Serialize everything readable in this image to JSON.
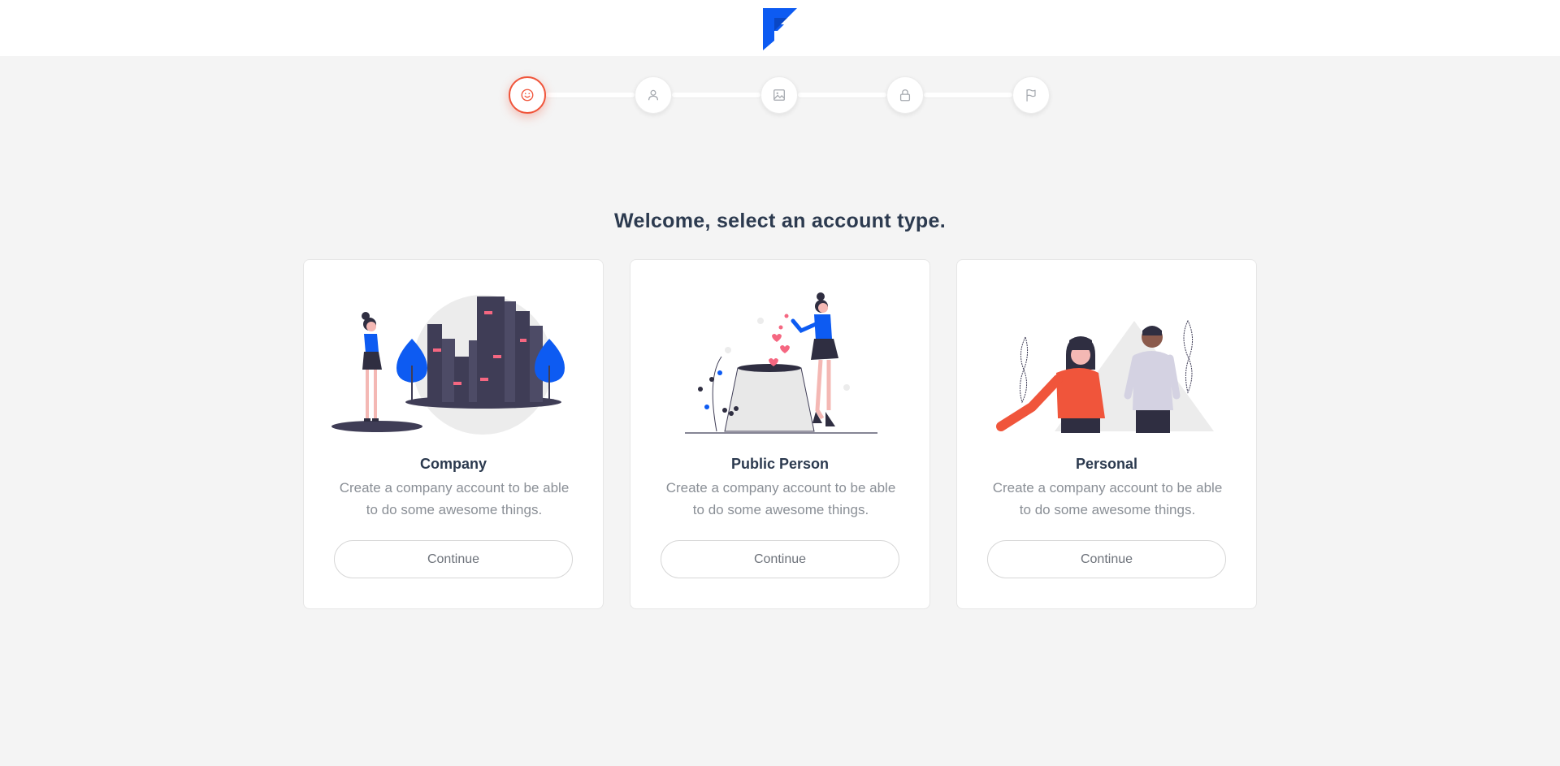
{
  "header": {
    "logo_icon": "flex-logo-icon",
    "brand_color": "#0d5bf2"
  },
  "stepper": {
    "active_color": "#f0553b",
    "steps": [
      {
        "icon": "smile-icon",
        "active": true
      },
      {
        "icon": "user-icon",
        "active": false
      },
      {
        "icon": "image-icon",
        "active": false
      },
      {
        "icon": "lock-icon",
        "active": false
      },
      {
        "icon": "flag-icon",
        "active": false
      }
    ]
  },
  "main": {
    "title": "Welcome, select an account type."
  },
  "cards": [
    {
      "title": "Company",
      "description": "Create a company account to be able to do some awesome things.",
      "button": "Continue",
      "illustration": "city-illustration"
    },
    {
      "title": "Public Person",
      "description": "Create a company account to be able to do some awesome things.",
      "button": "Continue",
      "illustration": "public-person-illustration"
    },
    {
      "title": "Personal",
      "description": "Create a company account to be able to do some awesome things.",
      "button": "Continue",
      "illustration": "couple-illustration"
    }
  ]
}
